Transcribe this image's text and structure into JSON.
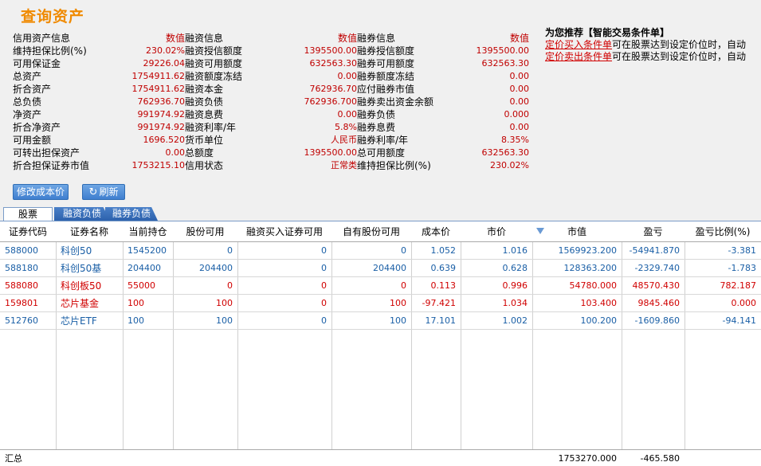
{
  "page_title": "查询资产",
  "credit_info": [
    {
      "key": "信用资产信息",
      "value": "数值"
    },
    {
      "key": "维持担保比例(%)",
      "value": "230.02%"
    },
    {
      "key": "可用保证金",
      "value": "29226.04"
    },
    {
      "key": "总资产",
      "value": "1754911.62"
    },
    {
      "key": "折合资产",
      "value": "1754911.62"
    },
    {
      "key": "总负债",
      "value": "762936.70"
    },
    {
      "key": "净资产",
      "value": "991974.92"
    },
    {
      "key": "折合净资产",
      "value": "991974.92"
    },
    {
      "key": "可用金额",
      "value": "1696.520"
    },
    {
      "key": "可转出担保资产",
      "value": "0.00"
    },
    {
      "key": "折合担保证券市值",
      "value": "1753215.10"
    }
  ],
  "margin_info": [
    {
      "key": "融资信息",
      "value": "数值"
    },
    {
      "key": "融资授信额度",
      "value": "1395500.00"
    },
    {
      "key": "融资可用额度",
      "value": "632563.30"
    },
    {
      "key": "融资额度冻结",
      "value": "0.00"
    },
    {
      "key": "融资本金",
      "value": "762936.70"
    },
    {
      "key": "融资负债",
      "value": "762936.700"
    },
    {
      "key": "融资息费",
      "value": "0.00"
    },
    {
      "key": "融资利率/年",
      "value": "5.8%"
    },
    {
      "key": "货币单位",
      "value": "人民币"
    },
    {
      "key": "总额度",
      "value": "1395500.00"
    },
    {
      "key": "信用状态",
      "value": "正常类"
    }
  ],
  "short_info": [
    {
      "key": "融券信息",
      "value": "数值"
    },
    {
      "key": "融券授信额度",
      "value": "1395500.00"
    },
    {
      "key": "融券可用额度",
      "value": "632563.30"
    },
    {
      "key": "融券额度冻结",
      "value": "0.00"
    },
    {
      "key": "应付融券市值",
      "value": "0.00"
    },
    {
      "key": "融券卖出资金余额",
      "value": "0.00"
    },
    {
      "key": "融券负债",
      "value": "0.000"
    },
    {
      "key": "融券息费",
      "value": "0.00"
    },
    {
      "key": "融券利率/年",
      "value": "8.35%"
    },
    {
      "key": "总可用额度",
      "value": "632563.30"
    },
    {
      "key": "维持担保比例(%)",
      "value": "230.02%"
    }
  ],
  "recommend": {
    "title": "为您推荐【智能交易条件单】",
    "buy_link": "定价买入条件单",
    "buy_text": "可在股票达到设定价位时，自动",
    "sell_link": "定价卖出条件单",
    "sell_text": "可在股票达到设定价位时，自动"
  },
  "buttons": {
    "modify": "修改成本价",
    "refresh": "刷新",
    "refresh_icon": "refresh-icon"
  },
  "tabs": [
    "股票",
    "融资负债",
    "融券负债"
  ],
  "table": {
    "headers": [
      "证券代码",
      "证券名称",
      "当前持仓",
      "股份可用",
      "融资买入证券可用",
      "自有股份可用",
      "成本价",
      "市价",
      "市值",
      "盈亏",
      "盈亏比例(%)"
    ],
    "rows": [
      {
        "code": "588000",
        "name": "科创50",
        "hold": "1545200",
        "avail": "0",
        "margin_avail": "0",
        "own_avail": "0",
        "cost": "1.052",
        "price": "1.016",
        "mkt_value": "1569923.200",
        "pnl": "-54941.870",
        "pnl_pct": "-3.381",
        "color": "blue"
      },
      {
        "code": "588180",
        "name": "科创50基",
        "hold": "204400",
        "avail": "204400",
        "margin_avail": "0",
        "own_avail": "204400",
        "cost": "0.639",
        "price": "0.628",
        "mkt_value": "128363.200",
        "pnl": "-2329.740",
        "pnl_pct": "-1.783",
        "color": "blue"
      },
      {
        "code": "588080",
        "name": "科创板50",
        "hold": "55000",
        "avail": "0",
        "margin_avail": "0",
        "own_avail": "0",
        "cost": "0.113",
        "price": "0.996",
        "mkt_value": "54780.000",
        "pnl": "48570.430",
        "pnl_pct": "782.187",
        "color": "red"
      },
      {
        "code": "159801",
        "name": "芯片基金",
        "hold": "100",
        "avail": "100",
        "margin_avail": "0",
        "own_avail": "100",
        "cost": "-97.421",
        "price": "1.034",
        "mkt_value": "103.400",
        "pnl": "9845.460",
        "pnl_pct": "0.000",
        "color": "red"
      },
      {
        "code": "512760",
        "name": "芯片ETF",
        "hold": "100",
        "avail": "100",
        "margin_avail": "0",
        "own_avail": "100",
        "cost": "17.101",
        "price": "1.002",
        "mkt_value": "100.200",
        "pnl": "-1609.860",
        "pnl_pct": "-94.141",
        "color": "blue"
      }
    ],
    "summary": {
      "label": "汇总",
      "mkt_value": "1753270.000",
      "pnl": "-465.580"
    }
  },
  "colors": {
    "title": "#f08a00",
    "value_red": "#c00000",
    "row_blue": "#1a5fa6",
    "row_red": "#d00000",
    "button_blue": "#3f7fcf"
  }
}
